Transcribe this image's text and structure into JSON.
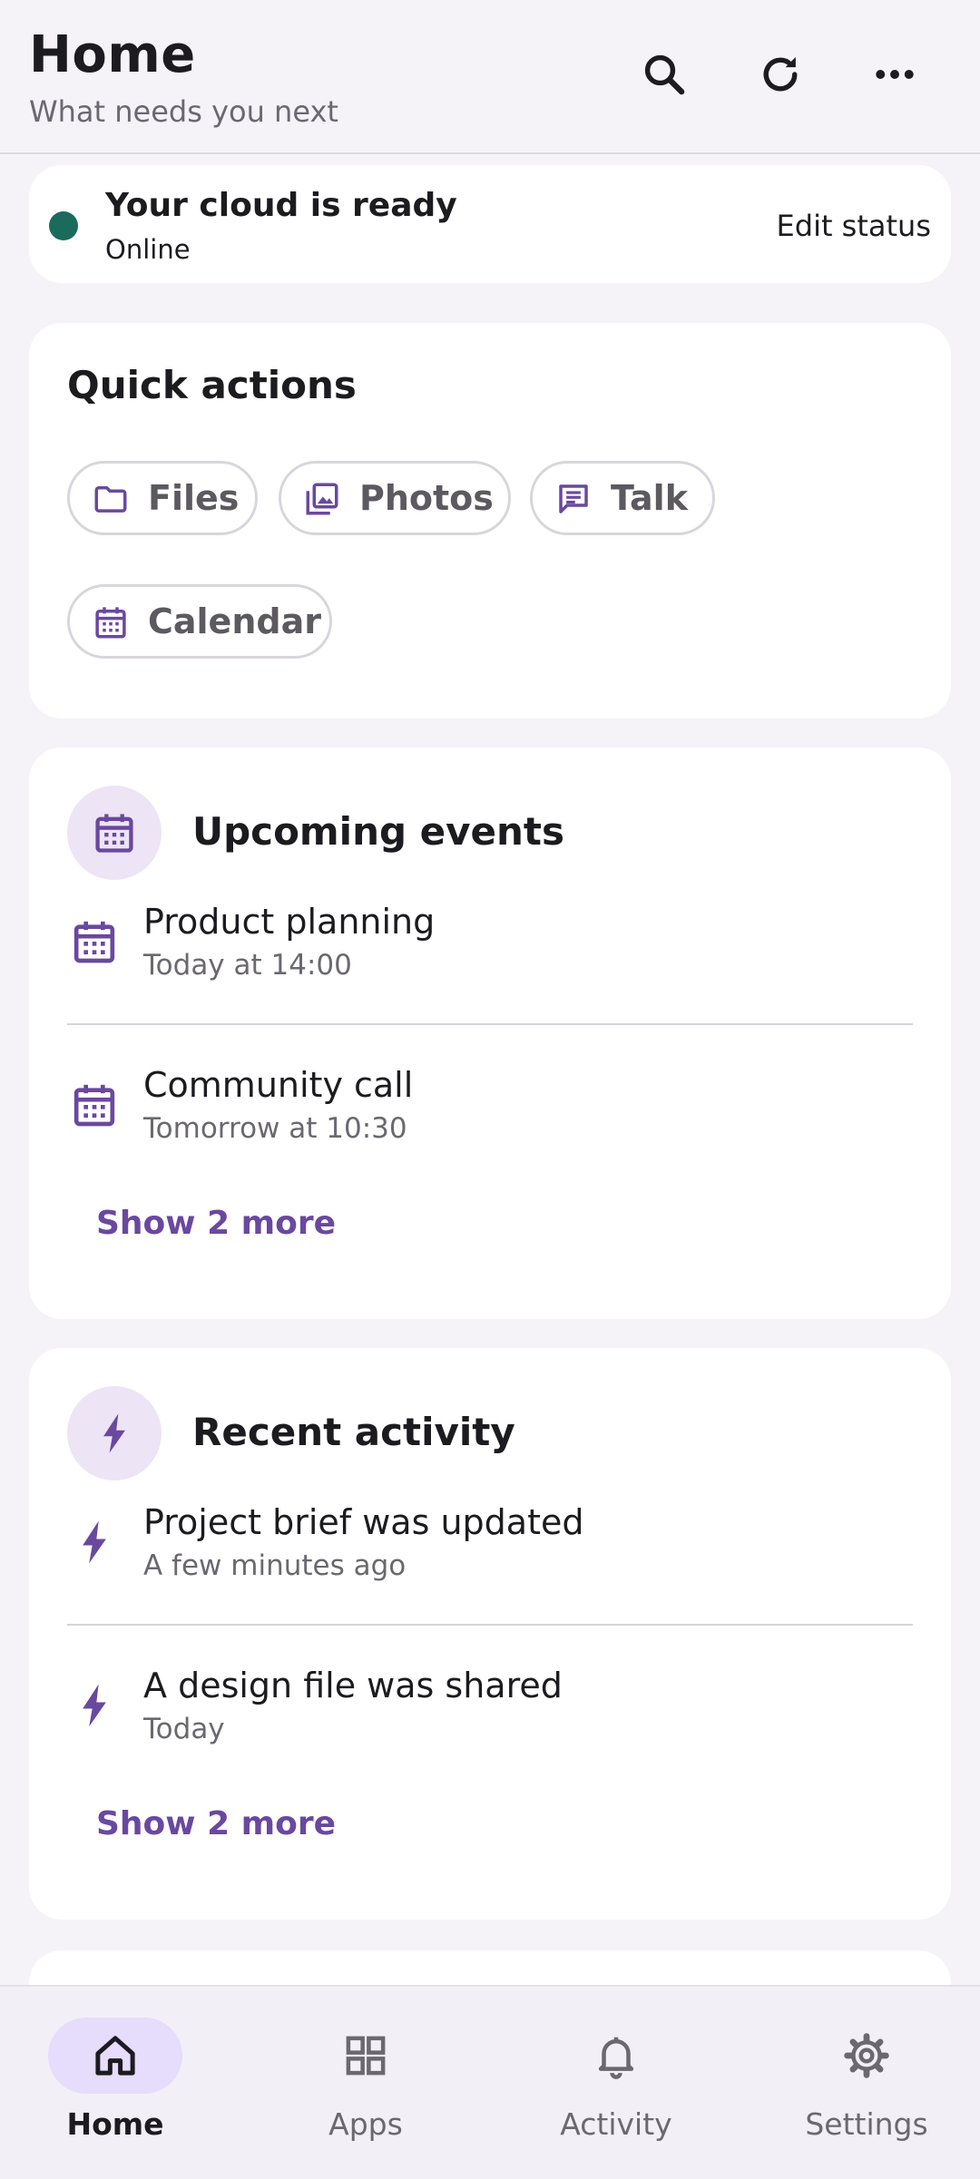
{
  "header": {
    "title": "Home",
    "subtitle": "What needs you next",
    "icons": [
      "search-icon",
      "refresh-icon",
      "more-icon"
    ]
  },
  "status": {
    "title": "Your cloud is ready",
    "state": "Online",
    "edit_label": "Edit status",
    "dot_color": "#1a6b5c"
  },
  "quick_actions": {
    "title": "Quick actions",
    "items": [
      {
        "label": "Files",
        "icon": "folder-icon"
      },
      {
        "label": "Photos",
        "icon": "photos-icon"
      },
      {
        "label": "Talk",
        "icon": "chat-icon"
      },
      {
        "label": "Calendar",
        "icon": "calendar-icon"
      }
    ]
  },
  "events": {
    "title": "Upcoming events",
    "items": [
      {
        "title": "Product planning",
        "time": "Today at 14:00"
      },
      {
        "title": "Community call",
        "time": "Tomorrow at 10:30"
      }
    ],
    "show_more": "Show 2 more"
  },
  "activity": {
    "title": "Recent activity",
    "items": [
      {
        "title": "Project brief was updated",
        "time": "A few minutes ago"
      },
      {
        "title": "A design file was shared",
        "time": "Today"
      }
    ],
    "show_more": "Show 2 more"
  },
  "nav": {
    "items": [
      {
        "label": "Home",
        "icon": "home-icon",
        "active": true
      },
      {
        "label": "Apps",
        "icon": "apps-icon",
        "active": false
      },
      {
        "label": "Activity",
        "icon": "bell-icon",
        "active": false
      },
      {
        "label": "Settings",
        "icon": "gear-icon",
        "active": false
      }
    ]
  },
  "colors": {
    "accent": "#6a48a0",
    "accent_light": "#ede4f5",
    "background": "#f5f3f8",
    "online": "#1a6b5c"
  }
}
